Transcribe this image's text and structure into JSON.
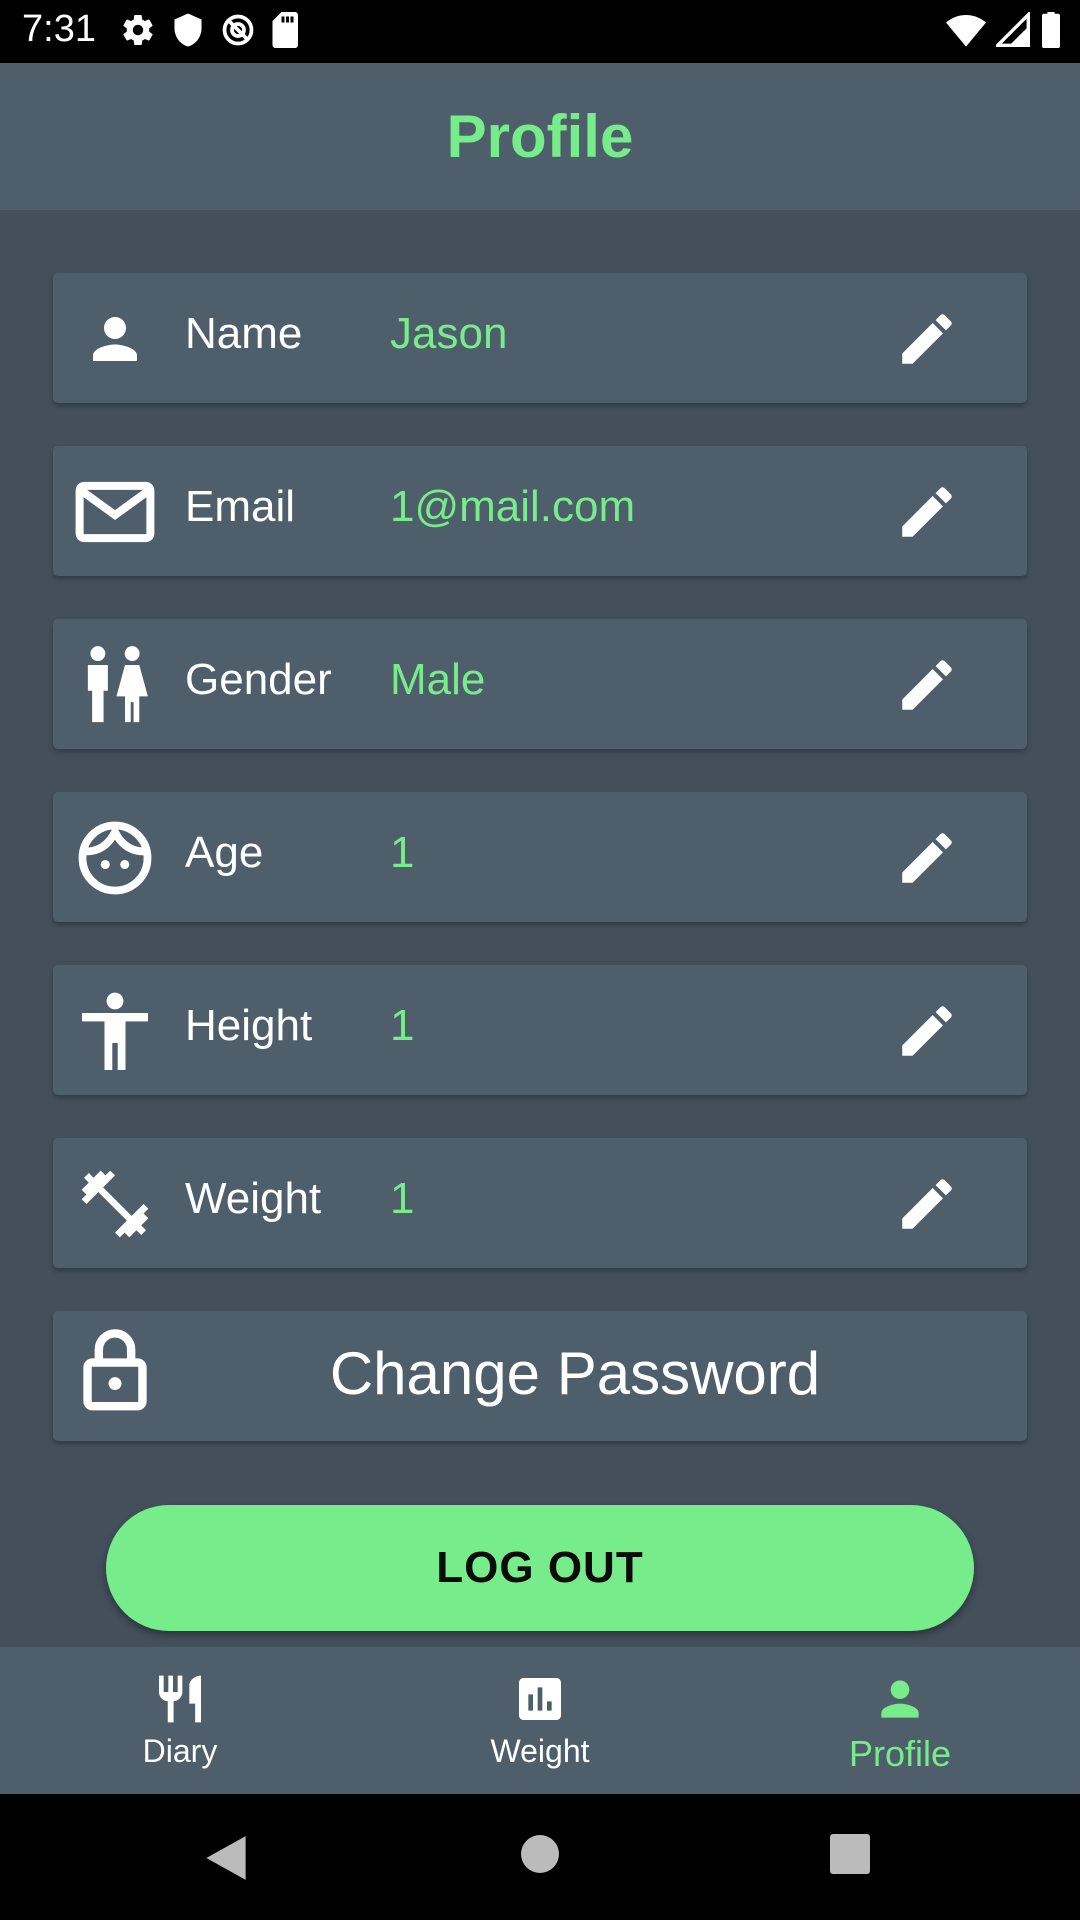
{
  "status_bar": {
    "time": "7:31",
    "left_icons": [
      "gear-icon",
      "shield-icon",
      "no-sync-icon",
      "sd-card-icon"
    ],
    "right_icons": [
      "wifi-icon",
      "signal-icon",
      "battery-icon"
    ]
  },
  "header": {
    "title": "Profile"
  },
  "profile_fields": [
    {
      "icon": "person-icon",
      "label": "Name",
      "value": "Jason"
    },
    {
      "icon": "mail-icon",
      "label": "Email",
      "value": "1@mail.com"
    },
    {
      "icon": "gender-icon",
      "label": "Gender",
      "value": "Male"
    },
    {
      "icon": "face-icon",
      "label": "Age",
      "value": "1"
    },
    {
      "icon": "height-icon",
      "label": "Height",
      "value": "1"
    },
    {
      "icon": "dumbbell-icon",
      "label": "Weight",
      "value": "1"
    }
  ],
  "change_password": {
    "icon": "lock-icon",
    "label": "Change Password"
  },
  "logout": {
    "label": "LOG OUT"
  },
  "bottom_nav": [
    {
      "icon": "fork-knife-icon",
      "label": "Diary",
      "active": false
    },
    {
      "icon": "bar-chart-icon",
      "label": "Weight",
      "active": false
    },
    {
      "icon": "person-icon",
      "label": "Profile",
      "active": true
    }
  ],
  "colors": {
    "accent": "#77ec8a",
    "background": "#434f5b",
    "surface": "#4f5e6b",
    "text": "#ffffff"
  }
}
